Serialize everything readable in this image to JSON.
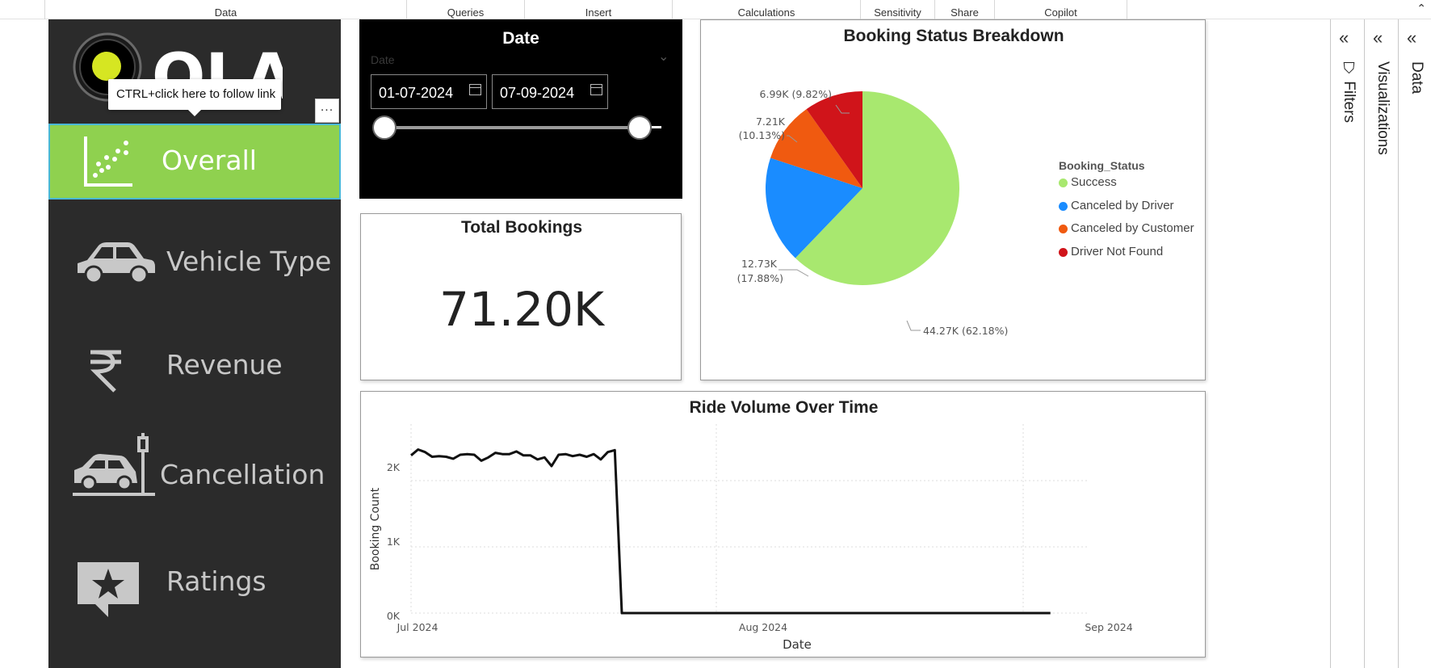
{
  "ribbon": {
    "groups": [
      "Data",
      "Queries",
      "Insert",
      "Calculations",
      "Sensitivity",
      "Share",
      "Copilot"
    ],
    "collapse_icon": "chevron-up-icon"
  },
  "sidebar": {
    "logo_text": "OLA",
    "tooltip": "CTRL+click here to follow link",
    "more_label": "...",
    "items": [
      {
        "label": "Overall",
        "icon": "scatter-chart-icon",
        "active": true
      },
      {
        "label": "Vehicle Type",
        "icon": "car-icon"
      },
      {
        "label": "Revenue",
        "icon": "rupee-icon"
      },
      {
        "label": "Cancellation",
        "icon": "car-crash-icon"
      },
      {
        "label": "Ratings",
        "icon": "star-message-icon"
      }
    ],
    "accent": "#8fd14f"
  },
  "date_slicer": {
    "title": "Date",
    "placeholder": "Date",
    "from": "01-07-2024",
    "to": "07-09-2024"
  },
  "kpi": {
    "title": "Total Bookings",
    "value": "71.20K"
  },
  "pie": {
    "title": "Booking Status Breakdown",
    "labels": [
      "44.27K (62.18%)",
      "12.73K",
      "(17.88%)",
      "7.21K",
      "(10.13%)",
      "6.99K (9.82%)"
    ],
    "legend_title": "Booking_Status"
  },
  "line": {
    "title": "Ride Volume Over Time",
    "ylabel": "Booking Count",
    "xlabel": "Date",
    "yticks": [
      "0K",
      "1K",
      "2K"
    ],
    "xticks": [
      "Jul 2024",
      "Aug 2024",
      "Sep 2024"
    ]
  },
  "chart_data": [
    {
      "type": "pie",
      "title": "Booking Status Breakdown",
      "legend_title": "Booking_Status",
      "legend_placement": "right",
      "categories": [
        "Success",
        "Canceled by Driver",
        "Canceled by Customer",
        "Driver Not Found"
      ],
      "values": [
        44270,
        12730,
        7210,
        6990
      ],
      "percentages": [
        62.18,
        17.88,
        10.13,
        9.82
      ],
      "colors": [
        "#a8e86f",
        "#1a8cff",
        "#f05a10",
        "#d0141a"
      ]
    },
    {
      "type": "line",
      "title": "Ride Volume Over Time",
      "xlabel": "Date",
      "ylabel": "Booking Count",
      "x_start": "2024-07-01",
      "x_end": "2024-09-30",
      "ylim": [
        0,
        2500
      ],
      "grid": true,
      "series": [
        {
          "values": [
            2380,
            2470,
            2430,
            2360,
            2370,
            2360,
            2330,
            2390,
            2400,
            2390,
            2300,
            2350,
            2420,
            2400,
            2400,
            2440,
            2380,
            2380,
            2320,
            2350,
            2220,
            2390,
            2400,
            2370,
            2390,
            2360,
            2400,
            2320,
            2430,
            2460,
            0,
            0,
            0,
            0,
            0,
            0,
            0,
            0,
            0,
            0,
            0,
            0,
            0,
            0,
            0,
            0,
            0,
            0,
            0,
            0,
            0,
            0,
            0,
            0,
            0,
            0,
            0,
            0,
            0,
            0,
            0,
            0,
            0,
            0,
            0,
            0,
            0,
            0,
            0,
            0,
            0,
            0,
            0,
            0,
            0,
            0,
            0,
            0,
            0,
            0,
            0,
            0,
            0,
            0,
            0,
            0,
            0,
            0,
            0,
            0,
            0,
            0
          ]
        }
      ]
    }
  ],
  "panes": [
    {
      "label": "Filters",
      "icon": "filter-icon"
    },
    {
      "label": "Visualizations",
      "icon": "double-chevron-left-icon"
    },
    {
      "label": "Data",
      "icon": "double-chevron-left-icon"
    }
  ]
}
